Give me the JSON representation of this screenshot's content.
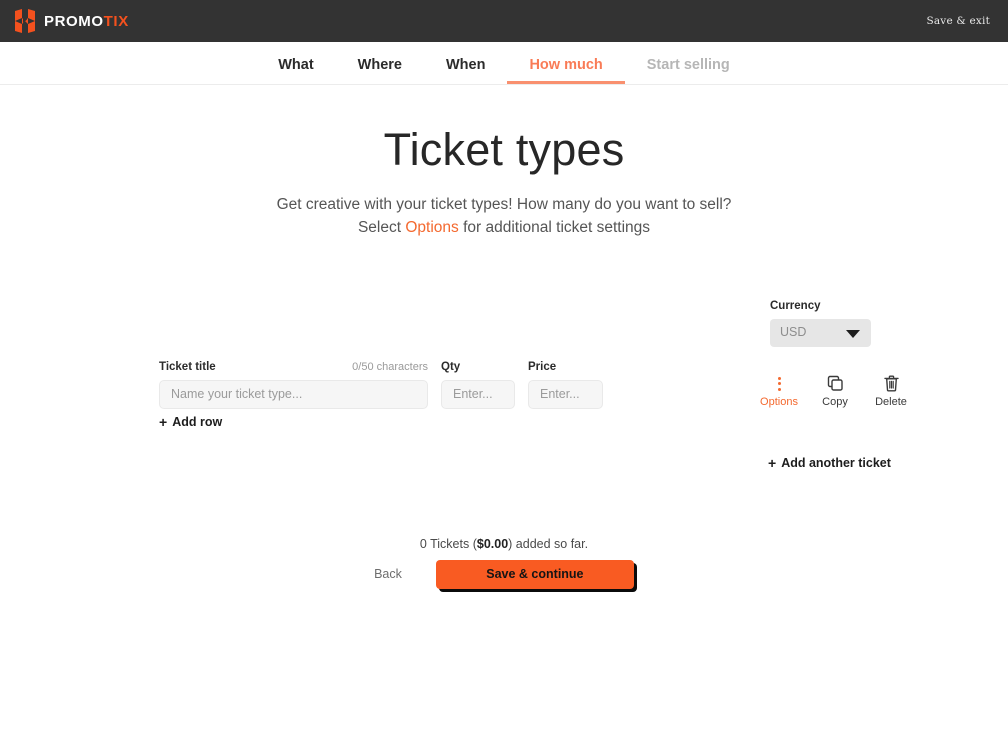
{
  "brand": {
    "name_white": "PROMO",
    "name_orange": "TIX",
    "logo_icon": "promotix-logo-icon"
  },
  "topbar": {
    "save_exit_label": "Save & exit"
  },
  "nav": {
    "tabs": [
      {
        "label": "What",
        "state": "default"
      },
      {
        "label": "Where",
        "state": "default"
      },
      {
        "label": "When",
        "state": "default"
      },
      {
        "label": "How much",
        "state": "active"
      },
      {
        "label": "Start selling",
        "state": "muted"
      }
    ]
  },
  "hero": {
    "title": "Ticket types",
    "subtitle_line1": "Get creative with your ticket types! How many do you want to sell?",
    "subtitle_line2_pre": "Select ",
    "subtitle_line2_accent": "Options",
    "subtitle_line2_post": " for additional ticket settings"
  },
  "currency": {
    "label": "Currency",
    "value": "USD",
    "chevron_icon": "chevron-down-icon"
  },
  "ticket_row": {
    "title_field": {
      "label": "Ticket title",
      "char_count": "0/50 characters",
      "placeholder": "Name your ticket type...",
      "value": ""
    },
    "qty_field": {
      "label": "Qty",
      "placeholder": "Enter...",
      "value": ""
    },
    "price_field": {
      "label": "Price",
      "placeholder": "Enter...",
      "value": ""
    },
    "add_row_label": "Add row",
    "plus_glyph": "+"
  },
  "row_actions": [
    {
      "label": "Options",
      "icon": "kebab-menu-icon"
    },
    {
      "label": "Copy",
      "icon": "copy-icon"
    },
    {
      "label": "Delete",
      "icon": "trash-icon"
    }
  ],
  "add_another_ticket": {
    "label": "Add another ticket",
    "plus_glyph": "+"
  },
  "summary": {
    "prefix": "0 Tickets (",
    "amount": "$0.00",
    "suffix": ") added so far."
  },
  "footer": {
    "back_label": "Back",
    "save_continue_label": "Save & continue"
  },
  "colors": {
    "brand_orange": "#F4511E",
    "accent_orange": "#F4692F",
    "button_orange": "#F95B22",
    "active_tab": "#F97B56",
    "topbar_dark": "#333333",
    "input_bg": "#f6f6f6",
    "muted_text": "#b6b6b6"
  }
}
